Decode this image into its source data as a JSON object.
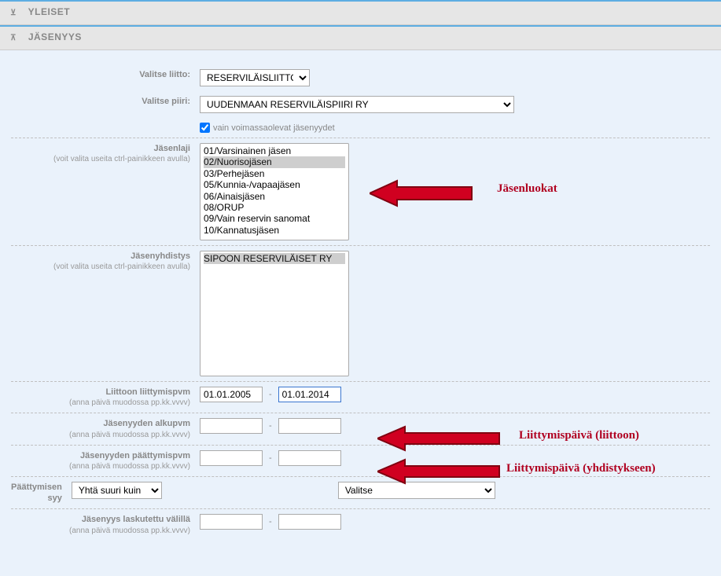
{
  "sections": {
    "yleiset": "YLEISET",
    "jasenyys": "JÄSENYYS"
  },
  "labels": {
    "liitto": "Valitse liitto:",
    "piiri": "Valitse piiri:",
    "voimassa": "vain voimassaolevat jäsenyydet",
    "jasenlaji": "Jäsenlaji",
    "ctrl_hint": "(voit valita useita ctrl-painikkeen avulla)",
    "jasenyhdistys": "Jäsenyhdistys",
    "liittoon_pvm": "Liittoon liittymispvm",
    "date_hint": "(anna päivä muodossa pp.kk.vvvv)",
    "alku_pvm": "Jäsenyyden alkupvm",
    "paatt_pvm": "Jäsenyyden päättymispvm",
    "paatt_syy": "Päättymisen syy",
    "laskutettu": "Jäsenyys laskutettu välillä"
  },
  "fields": {
    "liitto_selected": "RESERVILÄISLIITTO",
    "piiri_selected": "UUDENMAAN RESERVILÄISPIIRI RY",
    "voimassa_checked": true,
    "jasenlaji_options": [
      "01/Varsinainen jäsen",
      "02/Nuorisojäsen",
      "03/Perhejäsen",
      "05/Kunnia-/vapaajäsen",
      "06/Ainaisjäsen",
      "08/ORUP",
      "09/Vain reservin sanomat",
      "10/Kannatusjäsen"
    ],
    "jasenlaji_selected_index": 1,
    "jasenyhdistys_options": [
      "SIPOON RESERVILÄISET RY"
    ],
    "liittoon_from": "01.01.2005",
    "liittoon_to": "01.01.2014",
    "alku_from": "",
    "alku_to": "",
    "paatt_from": "",
    "paatt_to": "",
    "compare_selected": "Yhtä suuri kuin",
    "valitse_selected": "Valitse",
    "lask_from": "",
    "lask_to": ""
  },
  "annotations": {
    "a1": "Jäsenluokat",
    "a2": "Liittymispäivä (liittoon)",
    "a3": "Liittymispäivä (yhdistykseen)"
  }
}
